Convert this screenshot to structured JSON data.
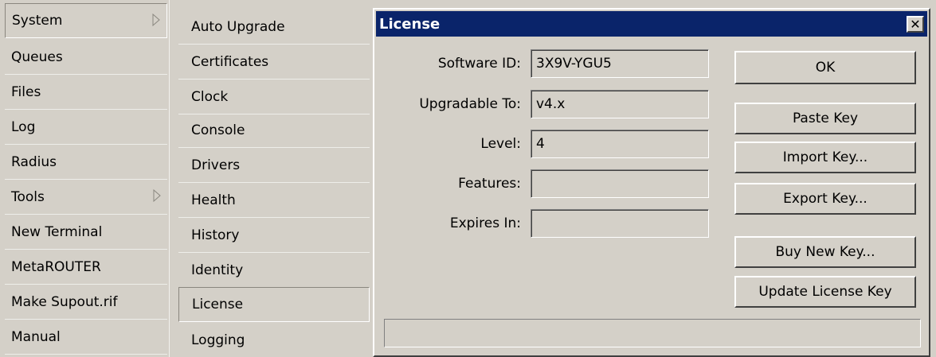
{
  "main_menu": {
    "items": [
      {
        "label": "System",
        "has_submenu": true,
        "selected": true
      },
      {
        "label": "Queues"
      },
      {
        "label": "Files"
      },
      {
        "label": "Log"
      },
      {
        "label": "Radius"
      },
      {
        "label": "Tools",
        "has_submenu": true
      },
      {
        "label": "New Terminal"
      },
      {
        "label": "MetaROUTER"
      },
      {
        "label": "Make Supout.rif"
      },
      {
        "label": "Manual"
      }
    ]
  },
  "system_submenu": {
    "items": [
      {
        "label": "Auto Upgrade"
      },
      {
        "label": "Certificates"
      },
      {
        "label": "Clock"
      },
      {
        "label": "Console"
      },
      {
        "label": "Drivers"
      },
      {
        "label": "Health"
      },
      {
        "label": "History"
      },
      {
        "label": "Identity"
      },
      {
        "label": "License",
        "selected": true
      },
      {
        "label": "Logging"
      }
    ]
  },
  "license_dialog": {
    "title": "License",
    "close_glyph": "✕",
    "fields": {
      "software_id": {
        "label": "Software ID:",
        "value": "3X9V-YGU5"
      },
      "upgradable_to": {
        "label": "Upgradable To:",
        "value": "v4.x"
      },
      "level": {
        "label": "Level:",
        "value": "4"
      },
      "features": {
        "label": "Features:",
        "value": ""
      },
      "expires_in": {
        "label": "Expires In:",
        "value": ""
      }
    },
    "buttons": {
      "ok": "OK",
      "paste_key": "Paste Key",
      "import_key": "Import Key...",
      "export_key": "Export Key...",
      "buy_new_key": "Buy New Key...",
      "update_license_key": "Update License Key"
    },
    "status": ""
  },
  "colors": {
    "face": "#d4d0c8",
    "titlebar": "#0a246a",
    "titletext": "#ffffff"
  }
}
